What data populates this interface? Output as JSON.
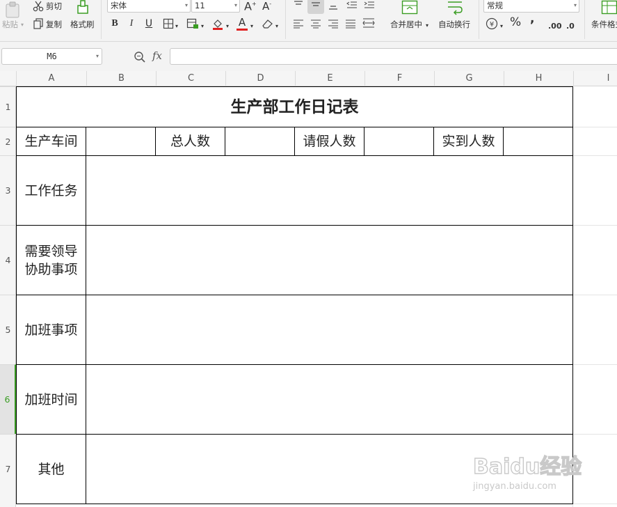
{
  "toolbar": {
    "paste_label": "粘贴",
    "cut_label": "剪切",
    "copy_label": "复制",
    "format_painter_label": "格式刷",
    "font_name": "宋体",
    "font_size": "11",
    "merge_center_label": "合并居中",
    "wrap_text_label": "自动换行",
    "number_format": "常规",
    "conditional_format_label": "条件格式",
    "percent_glyph": "%",
    "thousands_glyph": ",",
    "inc_decimal_label": ".00",
    "dec_decimal_label": ".0"
  },
  "formula_bar": {
    "cell_ref": "M6",
    "fx_label": "fx",
    "formula_value": ""
  },
  "columns": [
    "A",
    "B",
    "C",
    "D",
    "E",
    "F",
    "G",
    "H",
    "I"
  ],
  "rows": [
    "1",
    "2",
    "3",
    "4",
    "5",
    "6",
    "7"
  ],
  "active_row": "6",
  "sheet": {
    "title": "生产部工作日记表",
    "r2": {
      "workshop_label": "生产车间",
      "total_label": "总人数",
      "leave_label": "请假人数",
      "present_label": "实到人数"
    },
    "r3_label": "工作任务",
    "r4_label_line1": "需要领导",
    "r4_label_line2": "协助事项",
    "r5_label": "加班事项",
    "r6_label": "加班时间",
    "r7_label": "其他"
  },
  "watermark": {
    "brand": "Baidu经验",
    "url": "jingyan.baidu.com"
  },
  "colors": {
    "accent_green": "#3a9d23",
    "font_color_red": "#e02020",
    "fill_orange": "#f0b400"
  }
}
